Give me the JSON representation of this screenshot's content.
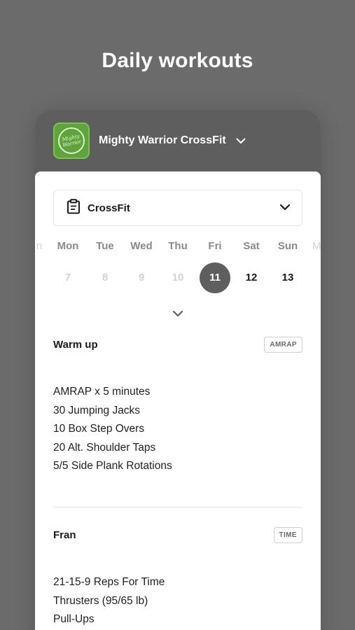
{
  "headline": "Daily workouts",
  "gym": {
    "name": "Mighty Warrior CrossFit",
    "logo_text": "Mighty Warrior",
    "logo_color": "#5ea33c"
  },
  "program": {
    "label": "CrossFit"
  },
  "calendar": {
    "prev_edge": "n",
    "next_edge": "M",
    "days": [
      {
        "name": "Mon",
        "num": "7",
        "state": "past"
      },
      {
        "name": "Tue",
        "num": "8",
        "state": "past"
      },
      {
        "name": "Wed",
        "num": "9",
        "state": "past"
      },
      {
        "name": "Thu",
        "num": "10",
        "state": "past"
      },
      {
        "name": "Fri",
        "num": "11",
        "state": "today"
      },
      {
        "name": "Sat",
        "num": "12",
        "state": "future"
      },
      {
        "name": "Sun",
        "num": "13",
        "state": "future"
      }
    ]
  },
  "sections": [
    {
      "title": "Warm up",
      "badge": "AMRAP",
      "lines": [
        "AMRAP x 5 minutes",
        "30 Jumping Jacks",
        "10 Box Step Overs",
        "20 Alt. Shoulder Taps",
        "5/5 Side Plank Rotations"
      ]
    },
    {
      "title": "Fran",
      "badge": "TIME",
      "lines": [
        "21-15-9 Reps For Time",
        "Thrusters (95/65 lb)",
        "Pull-Ups"
      ]
    }
  ],
  "colors": {
    "background": "#6b6b6b",
    "accent": "#5e5e5e",
    "card": "#ffffff"
  }
}
